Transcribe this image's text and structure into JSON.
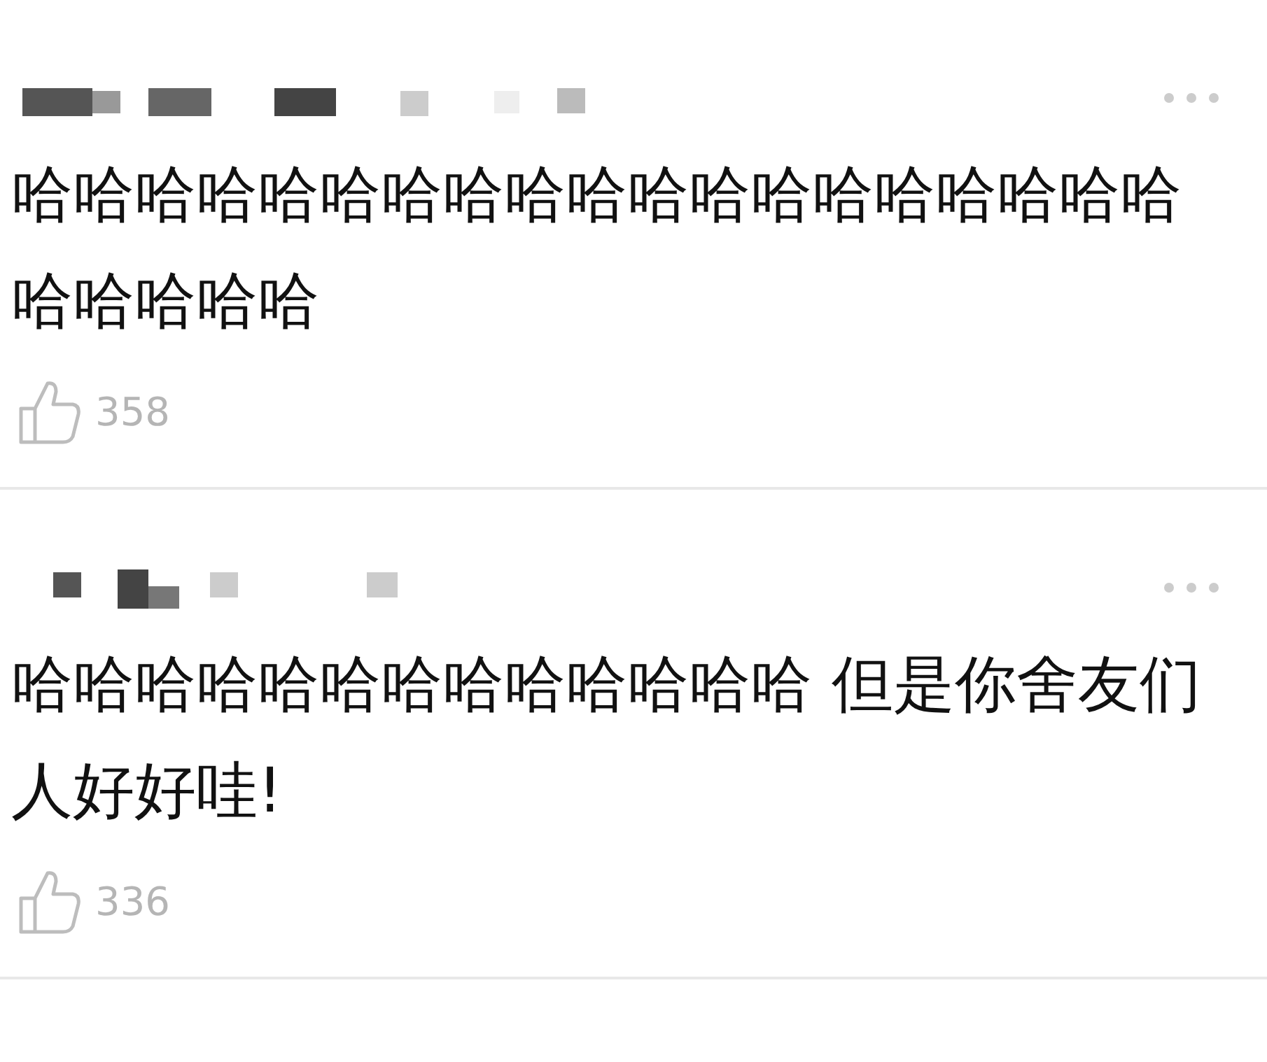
{
  "comments": [
    {
      "text": "哈哈哈哈哈哈哈哈哈哈哈哈哈哈哈哈哈哈哈哈哈哈哈哈",
      "likes": "358"
    },
    {
      "text": "哈哈哈哈哈哈哈哈哈哈哈哈哈 但是你舍友们人好好哇!",
      "likes": "336"
    }
  ]
}
